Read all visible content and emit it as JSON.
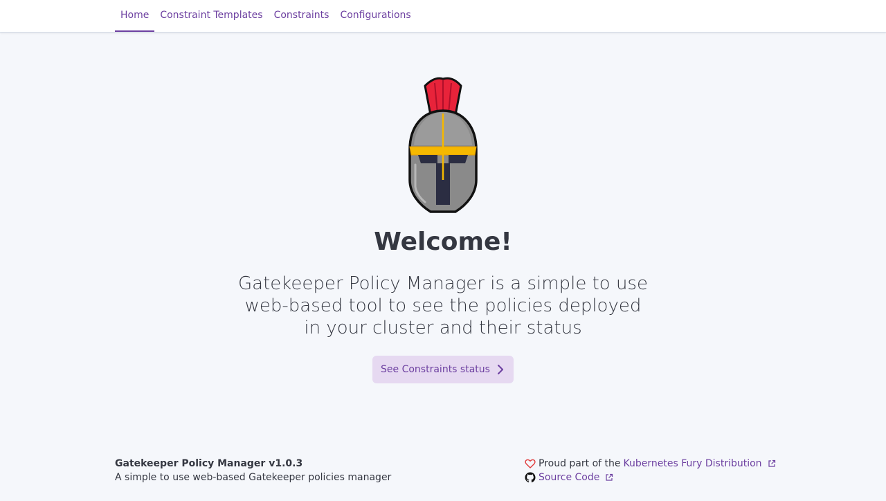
{
  "nav": {
    "tabs": [
      {
        "label": "Home"
      },
      {
        "label": "Constraint Templates"
      },
      {
        "label": "Constraints"
      },
      {
        "label": "Configurations"
      }
    ]
  },
  "hero": {
    "logo_icon": "spartan-helmet-icon",
    "title": "Welcome!",
    "description": "Gatekeeper Policy Manager is a simple to use web-based tool to see the policies deployed in your cluster and their status",
    "cta_label": "See Constraints status",
    "cta_icon": "chevron-right-icon"
  },
  "footer": {
    "title": "Gatekeeper Policy Manager v1.0.3",
    "subtitle": "A simple to use web-based Gatekeeper policies manager",
    "proud_text": "Proud part of the",
    "kfd_link": "Kubernetes Fury Distribution",
    "source_link": "Source Code"
  },
  "colors": {
    "accent": "#6c3fa0",
    "background": "#f5f7fb",
    "cta_background": "#e6d9f1",
    "text": "#343741"
  }
}
